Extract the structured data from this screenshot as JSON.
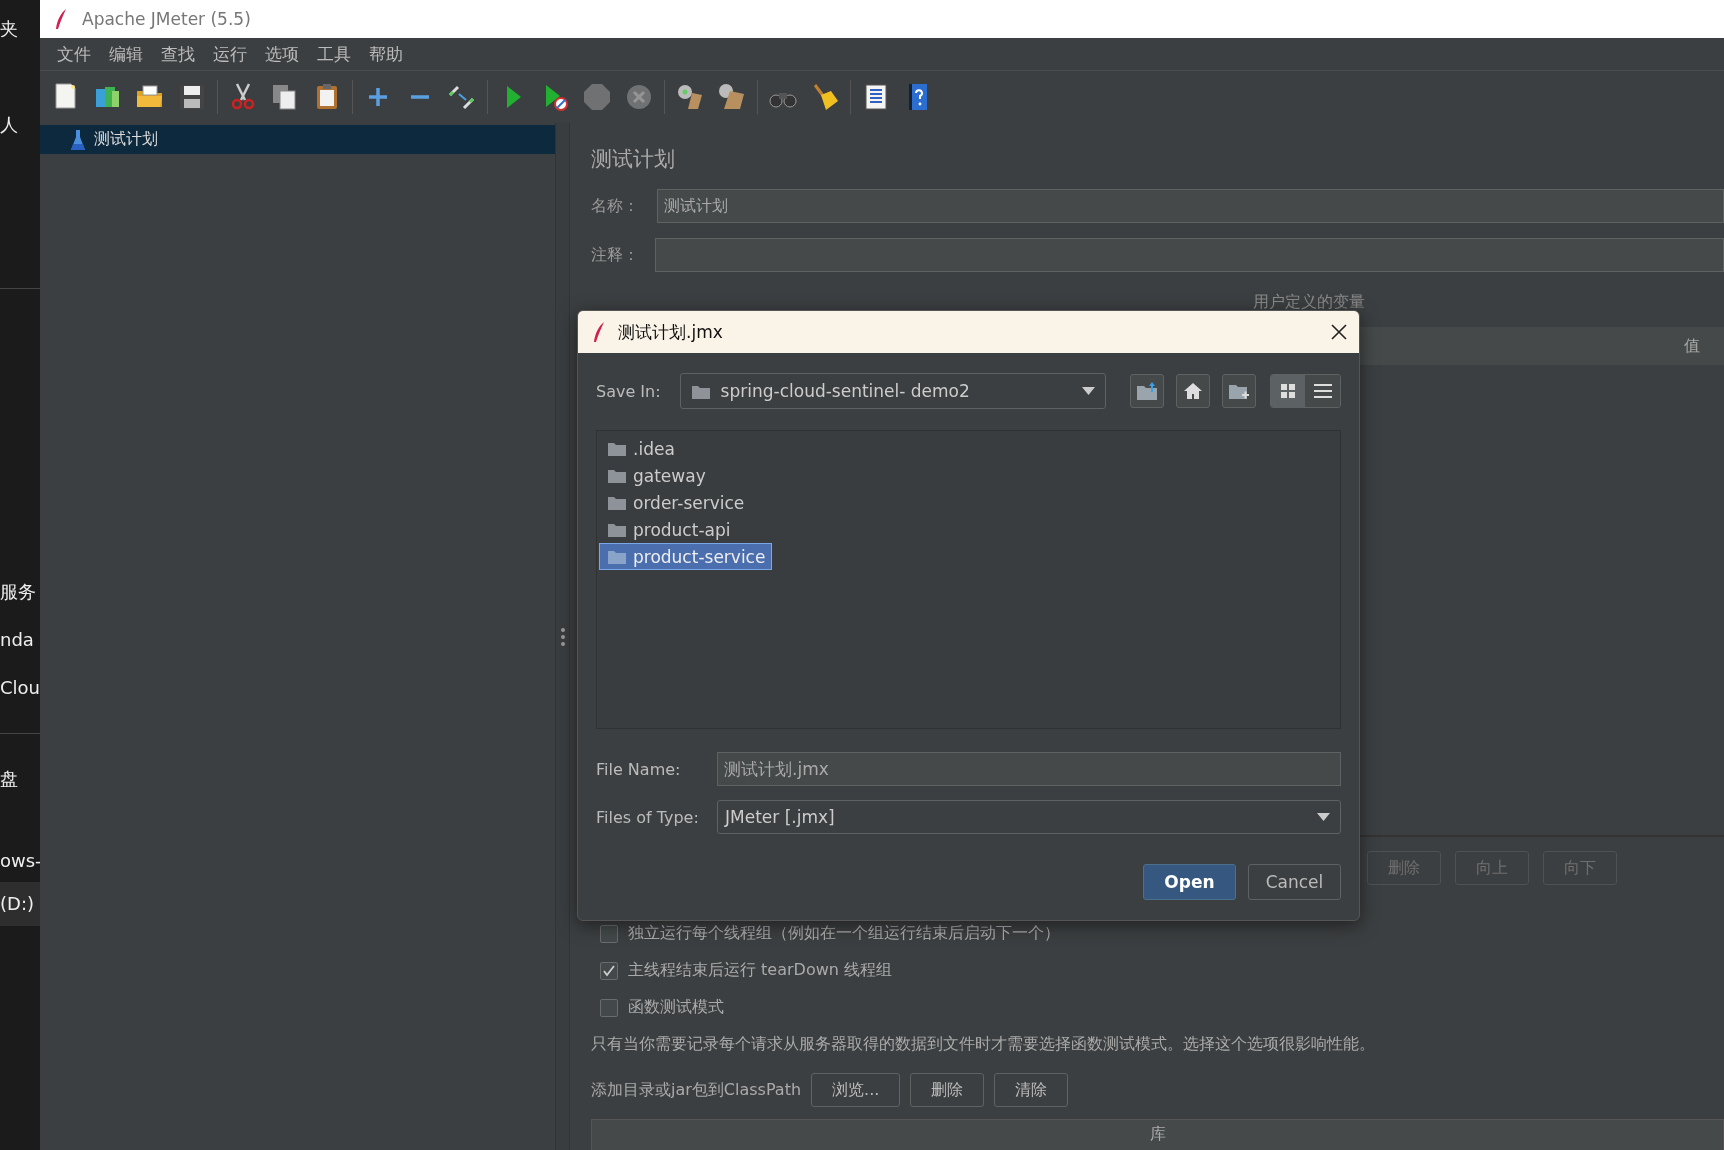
{
  "desktop_strip": [
    {
      "label": "夹",
      "selected": false
    },
    {
      "label": "人",
      "selected": false
    },
    {
      "label": "服务",
      "selected": false
    },
    {
      "label": "nda",
      "selected": false
    },
    {
      "label": "Clou",
      "selected": false
    },
    {
      "label": "盘",
      "selected": false
    },
    {
      "label": "ows-",
      "selected": false
    },
    {
      "label": "(D:)",
      "selected": true
    }
  ],
  "window": {
    "title": "Apache JMeter (5.5)"
  },
  "menu": [
    "文件",
    "编辑",
    "查找",
    "运行",
    "选项",
    "工具",
    "帮助"
  ],
  "toolbar": [
    [
      {
        "kind": "new",
        "disabled": false
      },
      {
        "kind": "templates",
        "disabled": false
      },
      {
        "kind": "open",
        "disabled": false
      },
      {
        "kind": "save",
        "disabled": false
      }
    ],
    [
      {
        "kind": "cut",
        "disabled": false
      },
      {
        "kind": "copy",
        "disabled": false
      },
      {
        "kind": "paste",
        "disabled": false
      }
    ],
    [
      {
        "kind": "expand",
        "disabled": false
      },
      {
        "kind": "collapse",
        "disabled": false
      },
      {
        "kind": "toggle",
        "disabled": false
      }
    ],
    [
      {
        "kind": "start",
        "disabled": false
      },
      {
        "kind": "start_no_pause",
        "disabled": false
      },
      {
        "kind": "stop",
        "disabled": true
      },
      {
        "kind": "shutdown",
        "disabled": true
      }
    ],
    [
      {
        "kind": "clear",
        "disabled": false
      },
      {
        "kind": "clear_all",
        "disabled": false
      }
    ],
    [
      {
        "kind": "search",
        "disabled": false
      },
      {
        "kind": "reset_search",
        "disabled": false
      }
    ],
    [
      {
        "kind": "log",
        "disabled": false
      },
      {
        "kind": "help",
        "disabled": false
      }
    ]
  ],
  "tree": [
    {
      "label": "测试计划",
      "selected": true
    }
  ],
  "test_plan": {
    "heading": "测试计划",
    "name_label": "名称：",
    "name_value": "测试计划",
    "comment_label": "注释：",
    "variables_title": "用户定义的变量",
    "value_column": "值",
    "table_buttons": [
      {
        "label": "删除",
        "disabled": true
      },
      {
        "label": "向上",
        "disabled": true
      },
      {
        "label": "向下",
        "disabled": true
      }
    ],
    "options": [
      {
        "label": "独立运行每个线程组（例如在一个组运行结束后启动下一个）",
        "checked": false
      },
      {
        "label": "主线程结束后运行 tearDown 线程组",
        "checked": true
      },
      {
        "label": "函数测试模式",
        "checked": false
      }
    ],
    "note": "只有当你需要记录每个请求从服务器取得的数据到文件时才需要选择函数测试模式。选择这个选项很影响性能。",
    "classpath_label": "添加目录或jar包到ClassPath",
    "classpath_buttons": [
      "浏览...",
      "删除",
      "清除"
    ],
    "library_column": "库"
  },
  "dialog": {
    "title": "测试计划.jmx",
    "save_in_label": "Save In:",
    "save_in_value": "spring-cloud-sentinel- demo2",
    "view_modes": [
      {
        "kind": "list",
        "selected": true
      },
      {
        "kind": "details",
        "selected": false
      }
    ],
    "folders": [
      {
        "label": ".idea",
        "selected": false
      },
      {
        "label": "gateway",
        "selected": false
      },
      {
        "label": "order-service",
        "selected": false
      },
      {
        "label": "product-api",
        "selected": false
      },
      {
        "label": "product-service",
        "selected": true
      }
    ],
    "file_name_label": "File Name:",
    "file_name": "测试计划.jmx",
    "file_type_label": "Files of Type:",
    "file_type": "JMeter [.jmx]",
    "buttons": [
      {
        "label": "Open",
        "default": true
      },
      {
        "label": "Cancel",
        "default": false
      }
    ]
  }
}
